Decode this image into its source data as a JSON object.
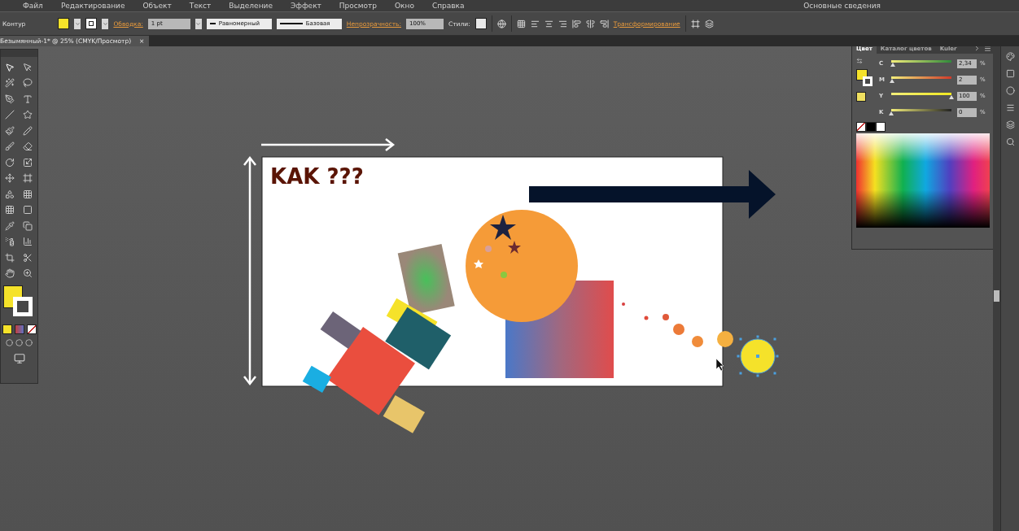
{
  "menu_bar": {
    "items": [
      "Файл",
      "Редактирование",
      "Объект",
      "Текст",
      "Выделение",
      "Эффект",
      "Просмотр",
      "Окно",
      "Справка"
    ],
    "workspace": "Основные сведения"
  },
  "control_bar": {
    "selection": "Контур",
    "stroke_label": "Обводка:",
    "stroke_weight": "1 pt",
    "profile": "Равномерный",
    "brush": "Базовая",
    "opacity_label": "Непрозрачность:",
    "opacity": "100%",
    "styles_label": "Стили:",
    "transform_label": "Трансформирование"
  },
  "document_tab": {
    "title": "Безымянный-1* @ 25% (CMYK/Просмотр)",
    "close": "×"
  },
  "color_panel": {
    "tabs": [
      {
        "label": "Цвет",
        "selected": true
      },
      {
        "label": "Каталог цветов",
        "selected": false
      },
      {
        "label": "Kuler",
        "selected": false
      }
    ],
    "channels": [
      {
        "name": "C",
        "value": "2,34",
        "unit": "%",
        "level": 0.0234
      },
      {
        "name": "M",
        "value": "2",
        "unit": "%",
        "level": 0.02
      },
      {
        "name": "Y",
        "value": "100",
        "unit": "%",
        "level": 1
      },
      {
        "name": "K",
        "value": "0",
        "unit": "%",
        "level": 0
      }
    ]
  },
  "artboard": {
    "heading": "KAK ???"
  }
}
